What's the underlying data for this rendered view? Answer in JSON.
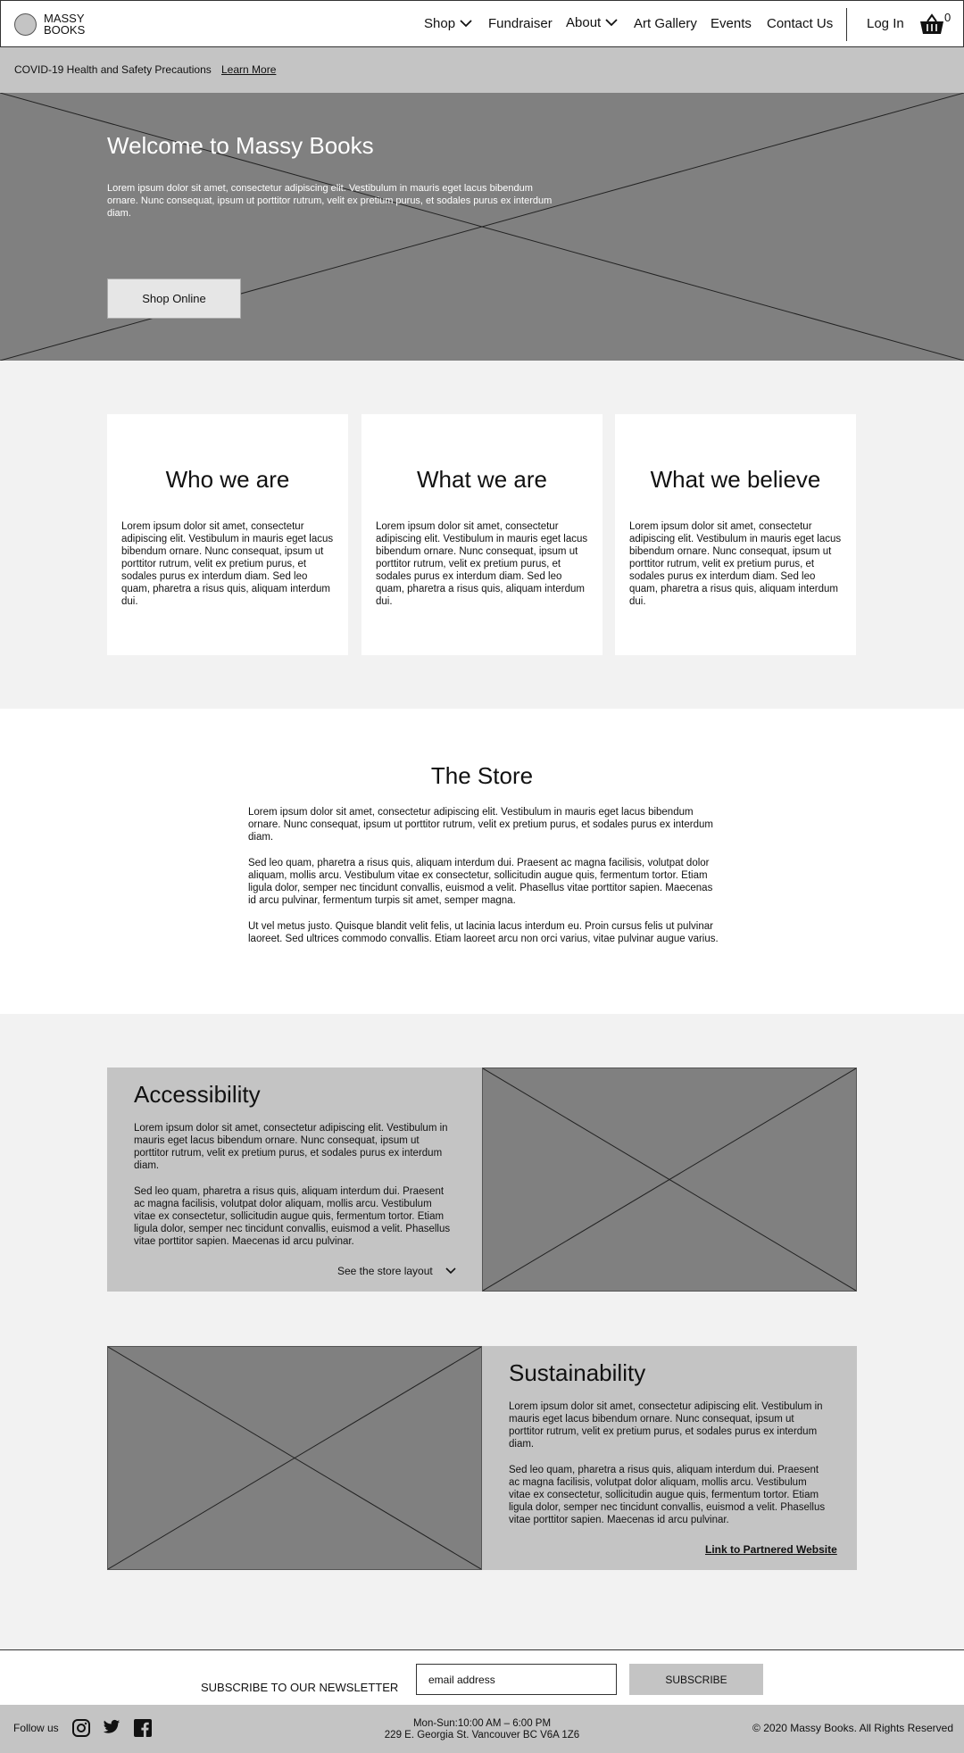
{
  "header": {
    "logo_line1": "MASSY",
    "logo_line2": "BOOKS",
    "nav": {
      "shop": "Shop",
      "fundraiser": "Fundraiser",
      "about": "About",
      "art_gallery": "Art Gallery",
      "events": "Events",
      "contact": "Contact Us",
      "login": "Log In"
    },
    "cart_count": "0"
  },
  "notice": {
    "text": "COVID-19 Health and Safety Precautions",
    "link": "Learn More"
  },
  "hero": {
    "title": "Welcome to Massy Books",
    "body": "Lorem ipsum dolor sit amet, consectetur adipiscing elit. Vestibulum in mauris eget lacus bibendum ornare. Nunc consequat, ipsum ut porttitor rutrum, velit ex pretium purus, et sodales purus ex interdum diam.",
    "button": "Shop Online"
  },
  "cards": [
    {
      "title": "Who we are",
      "body": "Lorem ipsum dolor sit amet, consectetur adipiscing elit. Vestibulum in mauris eget lacus bibendum ornare. Nunc consequat, ipsum ut porttitor rutrum, velit ex pretium purus, et sodales purus ex interdum diam. Sed leo quam, pharetra a risus quis, aliquam interdum dui."
    },
    {
      "title": "What we are",
      "body": "Lorem ipsum dolor sit amet, consectetur adipiscing elit. Vestibulum in mauris eget lacus bibendum ornare. Nunc consequat, ipsum ut porttitor rutrum, velit ex pretium purus, et sodales purus ex interdum diam. Sed leo quam, pharetra a risus quis, aliquam interdum dui."
    },
    {
      "title": "What we believe",
      "body": "Lorem ipsum dolor sit amet, consectetur adipiscing elit. Vestibulum in mauris eget lacus bibendum ornare. Nunc consequat, ipsum ut porttitor rutrum, velit ex pretium purus, et sodales purus ex interdum diam. Sed leo quam, pharetra a risus quis, aliquam interdum dui."
    }
  ],
  "store": {
    "title": "The Store",
    "p1": "Lorem ipsum dolor sit amet, consectetur adipiscing elit. Vestibulum in mauris eget lacus bibendum ornare. Nunc consequat, ipsum ut porttitor rutrum, velit ex pretium purus, et sodales purus ex interdum diam.",
    "p2": "Sed leo quam, pharetra a risus quis, aliquam interdum dui. Praesent ac magna facilisis, volutpat dolor aliquam, mollis arcu. Vestibulum vitae ex consectetur, sollicitudin augue quis, fermentum tortor. Etiam ligula dolor, semper nec tincidunt convallis, euismod a velit. Phasellus vitae porttitor sapien. Maecenas id arcu pulvinar, fermentum turpis sit amet, semper magna.",
    "p3": "Ut vel metus justo. Quisque blandit velit felis, ut lacinia lacus interdum eu. Proin cursus felis ut pulvinar laoreet. Sed ultrices commodo convallis. Etiam laoreet arcu non orci varius, vitae pulvinar augue varius."
  },
  "accessibility": {
    "title": "Accessibility",
    "p1": "Lorem ipsum dolor sit amet, consectetur adipiscing elit. Vestibulum in mauris eget lacus bibendum ornare. Nunc consequat, ipsum ut porttitor rutrum, velit ex pretium purus, et sodales purus ex interdum diam.",
    "p2": "Sed leo quam, pharetra a risus quis, aliquam interdum dui. Praesent ac magna facilisis, volutpat dolor aliquam, mollis arcu. Vestibulum vitae ex consectetur, sollicitudin augue quis, fermentum tortor. Etiam ligula dolor, semper nec tincidunt convallis, euismod a velit. Phasellus vitae porttitor sapien. Maecenas id arcu pulvinar.",
    "link": "See the store layout"
  },
  "sustainability": {
    "title": "Sustainability",
    "p1": "Lorem ipsum dolor sit amet, consectetur adipiscing elit. Vestibulum in mauris eget lacus bibendum ornare. Nunc consequat, ipsum ut porttitor rutrum, velit ex pretium purus, et sodales purus ex interdum diam.",
    "p2": "Sed leo quam, pharetra a risus quis, aliquam interdum dui. Praesent ac magna facilisis, volutpat dolor aliquam, mollis arcu. Vestibulum vitae ex consectetur, sollicitudin augue quis, fermentum tortor. Etiam ligula dolor, semper nec tincidunt convallis, euismod a velit. Phasellus vitae porttitor sapien. Maecenas id arcu pulvinar.",
    "link": "Link to Partnered Website"
  },
  "newsletter": {
    "label": "SUBSCRIBE TO OUR NEWSLETTER",
    "placeholder": "email address",
    "button": "SUBSCRIBE"
  },
  "footer": {
    "follow": "Follow us",
    "social_icons": [
      "instagram-icon",
      "twitter-icon",
      "facebook-icon"
    ],
    "hours": "Mon-Sun:10:00 AM – 6:00 PM",
    "address": "229 E. Georgia St. Vancouver BC  V6A 1Z6",
    "copyright": "© 2020 Massy Books. All Rights Reserved"
  },
  "colors": {
    "placeholder_dark": "#808080",
    "placeholder_light": "#c4c4c4",
    "page_bg": "#f2f2f2",
    "surface": "#ffffff"
  }
}
